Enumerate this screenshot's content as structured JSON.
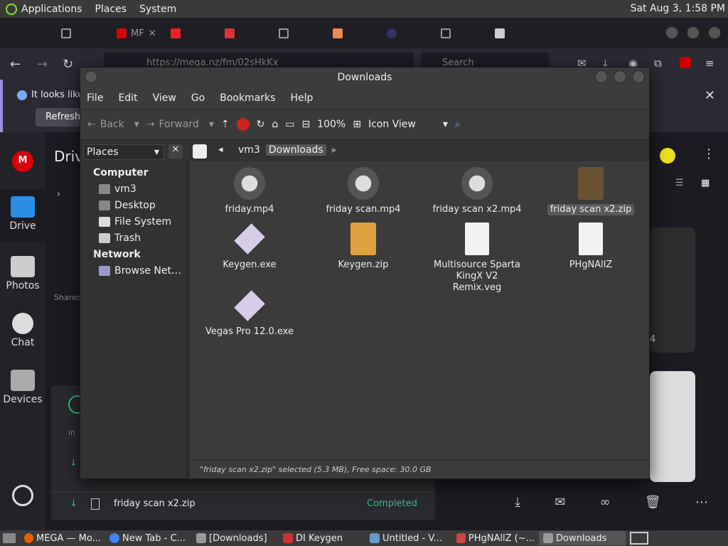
{
  "top_panel": {
    "applications": "Applications",
    "places": "Places",
    "system": "System",
    "clock": "Sat Aug  3,  1:58 PM"
  },
  "browser": {
    "tab_visible_text": "MF",
    "url": "https://mega.nz/fm/02sHkKx",
    "search_placeholder": "Search",
    "notification": {
      "text": "It looks like",
      "refresh": "Refresh"
    }
  },
  "mega": {
    "drive_title": "Driv",
    "nav": [
      {
        "label": "Drive"
      },
      {
        "label": "Photos"
      },
      {
        "label": "Chat"
      },
      {
        "label": "Devices"
      }
    ],
    "shared_label": "Shared",
    "in_label": "in",
    "thumb_badge": "4",
    "transfer": {
      "file": "friday scan x2.zip",
      "status": "Completed"
    }
  },
  "file_manager": {
    "title": "Downloads",
    "menu": [
      "File",
      "Edit",
      "View",
      "Go",
      "Bookmarks",
      "Help"
    ],
    "toolbar": {
      "back": "Back",
      "forward": "Forward",
      "zoom": "100%",
      "view_mode": "Icon View"
    },
    "places_dropdown": "Places",
    "breadcrumb": [
      "vm3",
      "Downloads"
    ],
    "sidebar": {
      "computer_header": "Computer",
      "computer_items": [
        "vm3",
        "Desktop",
        "File System",
        "Trash"
      ],
      "network_header": "Network",
      "network_items": [
        "Browse Net…"
      ]
    },
    "files": [
      {
        "name": "friday.mp4",
        "icon": "video-icon"
      },
      {
        "name": "friday scan.mp4",
        "icon": "video-icon"
      },
      {
        "name": "friday scan x2.mp4",
        "icon": "video-icon"
      },
      {
        "name": "friday scan x2.zip",
        "icon": "archive-icon"
      },
      {
        "name": "Keygen.exe",
        "icon": "executable-icon"
      },
      {
        "name": "Keygen.zip",
        "icon": "archive-icon"
      },
      {
        "name": "Multisource Sparta KingX V2 Remix.veg",
        "icon": "document-icon"
      },
      {
        "name": "PHgNAllZ",
        "icon": "document-icon"
      },
      {
        "name": "Vegas Pro 12.0.exe",
        "icon": "executable-icon"
      }
    ],
    "status": "\"friday scan x2.zip\" selected (5.3 MB), Free space: 30.0 GB"
  },
  "taskbar": [
    {
      "label": "MEGA — Mo...",
      "icon": "firefox-icon"
    },
    {
      "label": "New Tab - C...",
      "icon": "chrome-icon"
    },
    {
      "label": "[Downloads]",
      "icon": "folder-icon"
    },
    {
      "label": "DI Keygen",
      "icon": "keygen-icon"
    },
    {
      "label": "Untitled - V...",
      "icon": "vegas-icon"
    },
    {
      "label": "PHgNAllZ (~...",
      "icon": "text-editor-icon"
    },
    {
      "label": "Downloads",
      "icon": "folder-icon"
    }
  ],
  "colors": {
    "mega_red": "#d90007",
    "completed_green": "#2fbf87",
    "notification_accent": "#a38cd9"
  }
}
